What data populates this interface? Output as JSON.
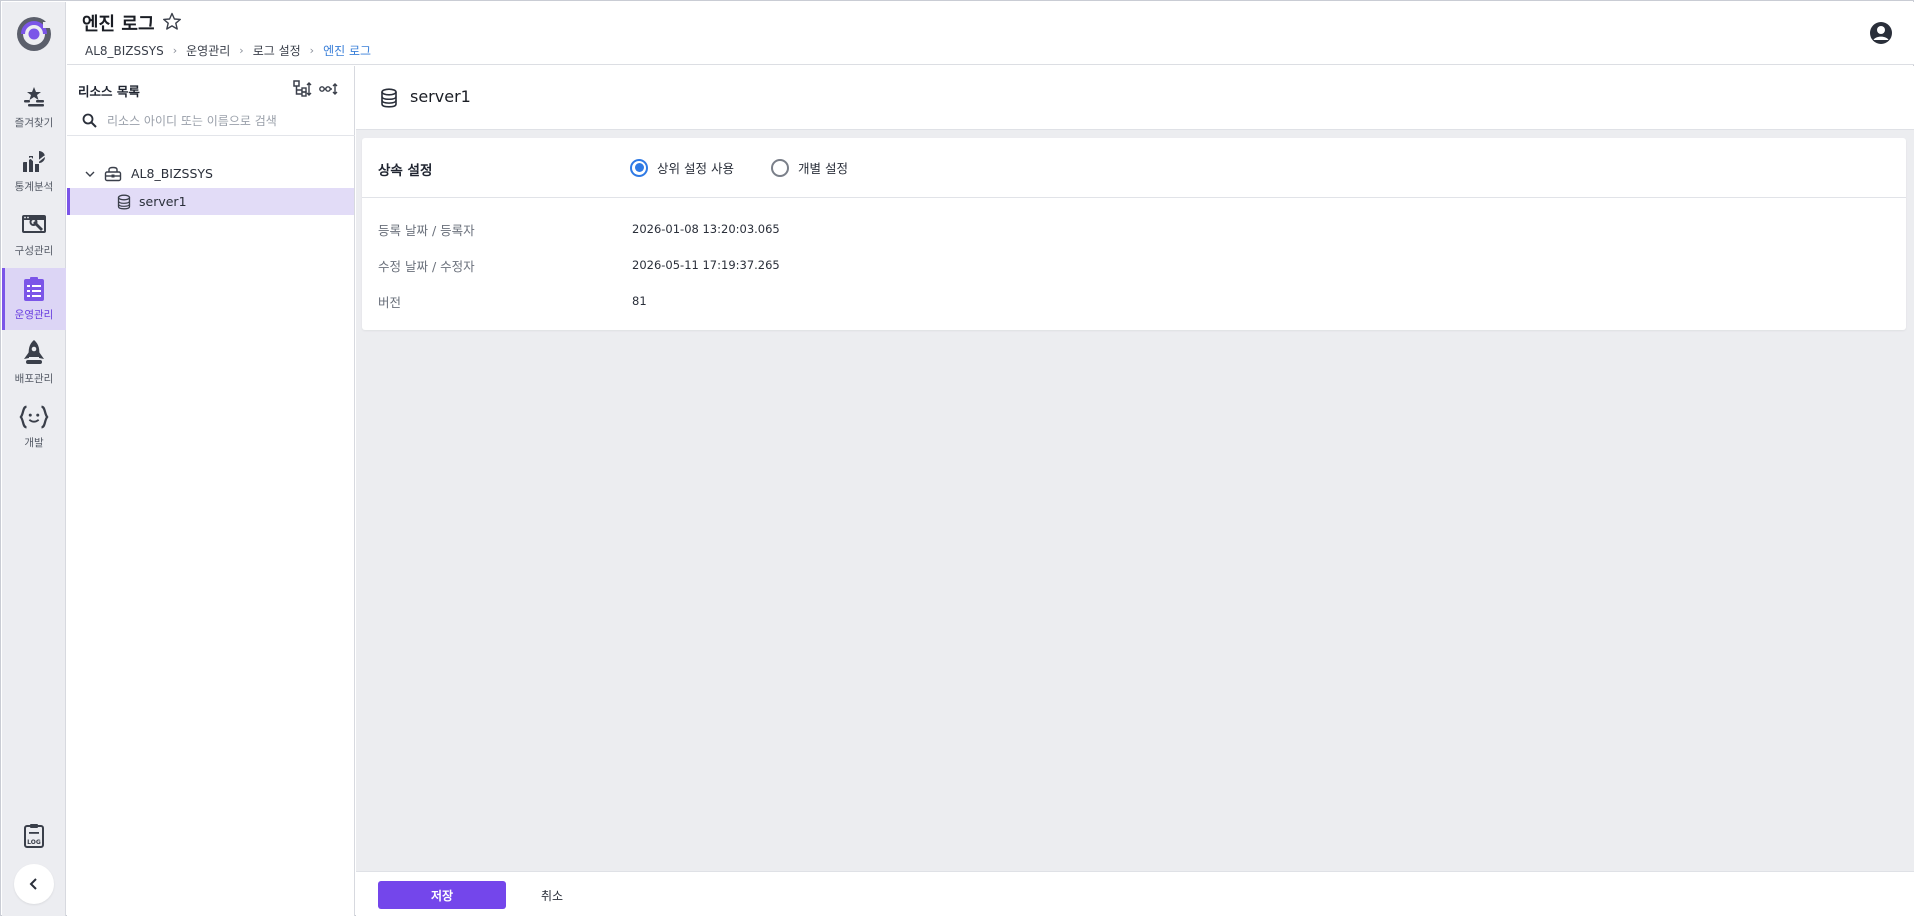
{
  "header": {
    "title": "엔진 로그",
    "breadcrumb": [
      "AL8_BIZSSYS",
      "운영관리",
      "로그 설정",
      "엔진 로그"
    ]
  },
  "nav": {
    "items": [
      {
        "label": "즐겨찾기",
        "icon": "favorites-icon"
      },
      {
        "label": "통계분석",
        "icon": "statistics-icon"
      },
      {
        "label": "구성관리",
        "icon": "configuration-icon"
      },
      {
        "label": "운영관리",
        "icon": "operations-icon",
        "active": true
      },
      {
        "label": "배포관리",
        "icon": "deploy-rocket-icon"
      },
      {
        "label": "개발",
        "icon": "development-braces-icon"
      }
    ]
  },
  "resources": {
    "title": "리소스 목록",
    "search_placeholder": "리소스 아이디 또는 이름으로 검색",
    "tree": {
      "root": "AL8_BIZSSYS",
      "children": [
        "server1"
      ],
      "selected": "server1"
    }
  },
  "detail": {
    "title": "server1",
    "inherit": {
      "label": "상속 설정",
      "options": [
        "상위 설정 사용",
        "개별 설정"
      ],
      "selected": "상위 설정 사용"
    },
    "info": [
      {
        "label": "등록 날짜 / 등록자",
        "value": "2026-01-08 13:20:03.065"
      },
      {
        "label": "수정 날짜 / 수정자",
        "value": "2026-05-11 17:19:37.265"
      },
      {
        "label": "버전",
        "value": "81"
      }
    ]
  },
  "footer": {
    "save_label": "저장",
    "cancel_label": "취소"
  },
  "colors": {
    "accent": "#7446eb",
    "radio_selected": "#2f7ae5",
    "breadcrumb_current": "#3a7fd8",
    "selected_bg": "#e2dcf7"
  }
}
